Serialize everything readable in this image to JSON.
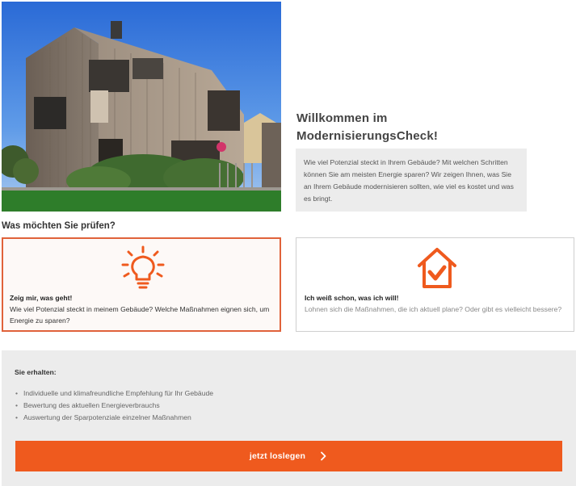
{
  "hero": {
    "image_alt": "Modernes Holzhaus im Abendlicht"
  },
  "welcome": {
    "title_line1": "Willkommen im",
    "title_line2": "ModernisierungsCheck!",
    "text": "Wie viel Potenzial steckt in Ihrem Gebäude? Mit welchen Schritten können Sie am meisten Energie sparen? Wir zeigen Ihnen, was Sie an Ihrem Gebäude modernisieren sollten, wie viel es kostet und was es bringt."
  },
  "question": {
    "heading": "Was möchten Sie prüfen?"
  },
  "options": [
    {
      "title": "Zeig mir, was geht!",
      "description": "Wie viel Potenzial steckt in meinem Gebäude? Welche Maßnahmen eignen sich, um Energie zu sparen?",
      "icon": "lightbulb-icon",
      "selected": true
    },
    {
      "title": "Ich weiß schon, was ich will!",
      "description": "Lohnen sich die Maßnahmen, die ich aktuell plane? Oder gibt es vielleicht bessere?",
      "icon": "house-check-icon",
      "selected": false
    }
  ],
  "benefits": {
    "heading": "Sie erhalten:",
    "items": [
      "Individuelle und klimafreundliche Empfehlung für Ihr Gebäude",
      "Bewertung des aktuellen Energieverbrauchs",
      "Auswertung der Sparpotenziale einzelner Maßnahmen"
    ]
  },
  "cta": {
    "label": "jetzt loslegen",
    "icon": "chevron-right-icon"
  },
  "colors": {
    "accent": "#ef5a1e",
    "selected_border": "#e0623a",
    "panel_bg": "#ececec"
  }
}
